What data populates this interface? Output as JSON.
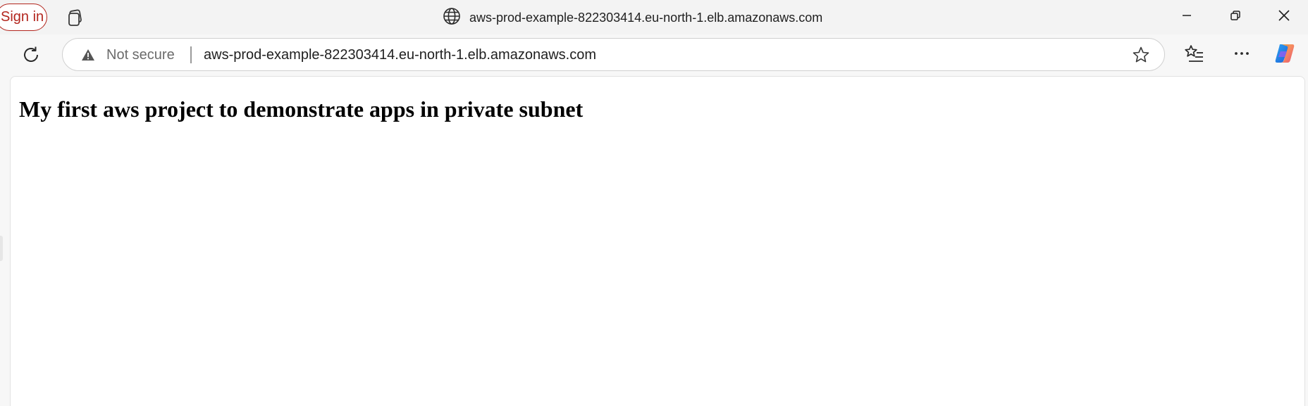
{
  "titlebar": {
    "signin_label": "Sign in",
    "title": "aws-prod-example-822303414.eu-north-1.elb.amazonaws.com",
    "icons": {
      "tabs": "workspaces-icon",
      "site": "globe-icon",
      "minimize": "minimize-icon",
      "restore": "restore-icon",
      "close": "close-icon"
    }
  },
  "toolbar": {
    "security_label": "Not secure",
    "url": "aws-prod-example-822303414.eu-north-1.elb.amazonaws.com",
    "icons": {
      "reload": "reload-icon",
      "warning": "warning-icon",
      "favorite": "star-icon",
      "favorites": "favorites-list-icon",
      "more": "more-icon",
      "copilot": "copilot-icon"
    }
  },
  "page": {
    "heading": "My first aws project to demonstrate apps in private subnet"
  },
  "colors": {
    "signin_accent": "#b3261e",
    "chrome_bg": "#f3f3f3",
    "page_bg": "#ffffff"
  }
}
